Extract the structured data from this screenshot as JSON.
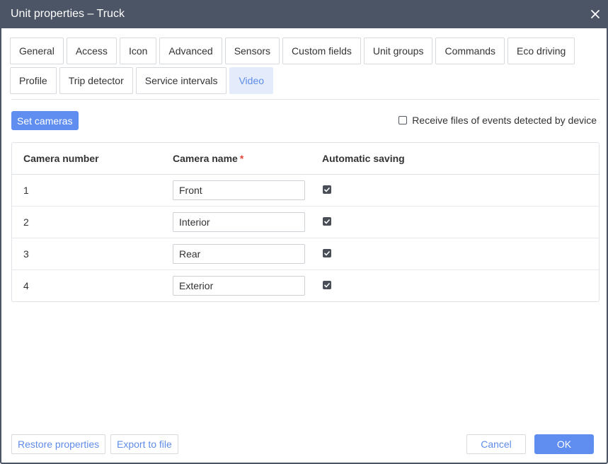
{
  "window": {
    "title": "Unit properties – Truck"
  },
  "tabs": {
    "row1": [
      "General",
      "Access",
      "Icon",
      "Advanced",
      "Sensors",
      "Custom fields",
      "Unit groups",
      "Commands",
      "Eco driving"
    ],
    "row2": [
      "Profile",
      "Trip detector",
      "Service intervals",
      "Video"
    ],
    "active": "Video"
  },
  "toolbar": {
    "set_cameras_label": "Set cameras",
    "receive_files_label": "Receive files of events detected by device",
    "receive_files_checked": false
  },
  "table": {
    "headers": {
      "camera_number": "Camera number",
      "camera_name": "Camera name",
      "required_mark": "*",
      "automatic_saving": "Automatic saving"
    },
    "rows": [
      {
        "number": "1",
        "name": "Front",
        "auto_save": true
      },
      {
        "number": "2",
        "name": "Interior",
        "auto_save": true
      },
      {
        "number": "3",
        "name": "Rear",
        "auto_save": true
      },
      {
        "number": "4",
        "name": "Exterior",
        "auto_save": true
      }
    ]
  },
  "footer": {
    "restore_label": "Restore properties",
    "export_label": "Export to file",
    "cancel_label": "Cancel",
    "ok_label": "OK"
  },
  "colors": {
    "titlebar": "#4b5566",
    "accent": "#5f8ef0",
    "active_tab_bg": "#e4ecfb",
    "required": "#e2483d"
  },
  "icons": {
    "close": "close-icon",
    "checkbox_checked": "checkbox-checked-icon",
    "checkbox_empty": "checkbox-icon"
  }
}
